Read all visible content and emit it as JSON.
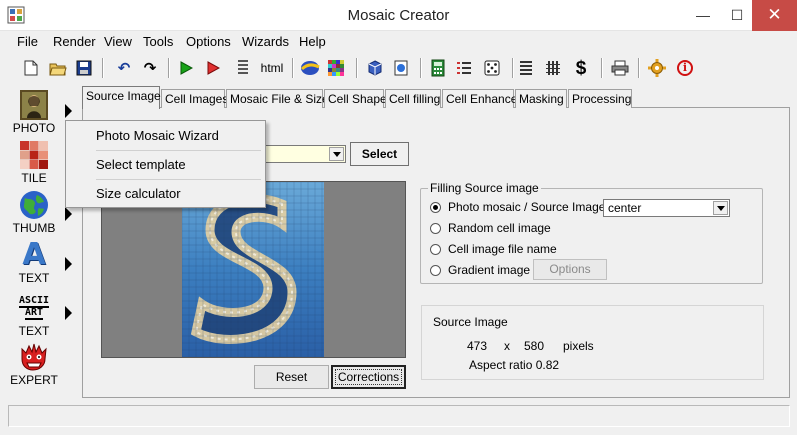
{
  "window": {
    "title": "Mosaic Creator",
    "minimize": "—",
    "maximize": "☐",
    "close": "✕"
  },
  "menu": [
    "File",
    "Render",
    "View",
    "Tools",
    "Options",
    "Wizards",
    "Help"
  ],
  "toolbar": {
    "html_label": "html",
    "dollar_label": "$",
    "info_label": "i"
  },
  "modes": [
    {
      "label": "PHOTO",
      "icon": "mona-lisa-icon"
    },
    {
      "label": "TILE",
      "icon": "tile-grid-icon"
    },
    {
      "label": "THUMB",
      "icon": "globe-icon"
    },
    {
      "label": "TEXT",
      "icon": "letter-a-icon",
      "glyph": "A"
    },
    {
      "label": "TEXT",
      "icon": "ascii-art-icon",
      "glyph_top": "ASCII",
      "glyph_bottom": "ART"
    },
    {
      "label": "EXPERT",
      "icon": "monster-icon"
    }
  ],
  "tabs": [
    "Source Image",
    "Cell Images",
    "Mosaic File & Size",
    "Cell Shape",
    "Cell filling",
    "Cell Enhance",
    "Masking",
    "Processing"
  ],
  "popup_menu": [
    "Photo Mosaic Wizard",
    "Select template",
    "Size calculator"
  ],
  "template": {
    "value": "",
    "select_label": "Select"
  },
  "buttons": {
    "reset": "Reset",
    "corrections": "Corrections"
  },
  "filling": {
    "legend": "Filling Source image",
    "options": [
      {
        "label": "Photo mosaic / Source Image",
        "selected": true
      },
      {
        "label": "Random cell image",
        "selected": false
      },
      {
        "label": "Cell image file name",
        "selected": false
      },
      {
        "label": "Gradient image",
        "selected": false
      }
    ],
    "position_value": "center",
    "options_button": "Options"
  },
  "source_info": {
    "heading": "Source Image",
    "width": "473",
    "times": "x",
    "height": "580",
    "unit": "pixels",
    "aspect": "Aspect ratio 0.82"
  },
  "colors": {
    "close_button": "#c74b46",
    "tooltip_yellow": "#ffffe1"
  }
}
